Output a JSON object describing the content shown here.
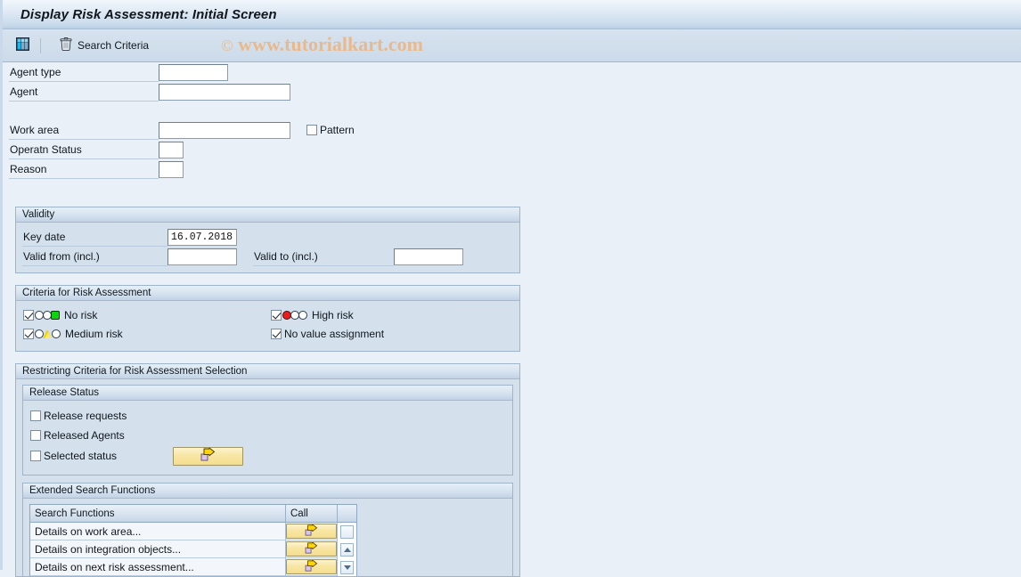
{
  "window": {
    "title": "Display Risk Assessment: Initial Screen"
  },
  "toolbar": {
    "grid_icon": "table-grid-icon",
    "delete_icon": "trash-icon",
    "search_criteria_label": "Search Criteria"
  },
  "watermark": {
    "copyright": "©",
    "text": "www.tutorialkart.com",
    "color": "#e9b98c"
  },
  "form": {
    "agent_type": {
      "label": "Agent type",
      "value": ""
    },
    "agent": {
      "label": "Agent",
      "value": ""
    },
    "work_area": {
      "label": "Work area",
      "value": ""
    },
    "pattern": {
      "label": "Pattern",
      "checked": false
    },
    "operatn_status": {
      "label": "Operatn Status",
      "value": ""
    },
    "reason": {
      "label": "Reason",
      "value": ""
    }
  },
  "validity": {
    "title": "Validity",
    "key_date": {
      "label": "Key date",
      "value": "16.07.2018"
    },
    "valid_from": {
      "label": "Valid from (incl.)",
      "value": ""
    },
    "valid_to": {
      "label": "Valid to (incl.)",
      "value": ""
    }
  },
  "criteria": {
    "title": "Criteria for Risk Assessment",
    "no_risk": {
      "label": "No risk",
      "checked": true,
      "icon": "traffic-light-green-icon"
    },
    "high_risk": {
      "label": "High risk",
      "checked": true,
      "icon": "traffic-light-red-icon"
    },
    "medium_risk": {
      "label": "Medium risk",
      "checked": true,
      "icon": "traffic-light-yellow-icon"
    },
    "no_value_assignment": {
      "label": "No value assignment",
      "checked": true
    }
  },
  "restricting": {
    "title": "Restricting Criteria for Risk Assessment Selection",
    "release_status": {
      "title": "Release Status",
      "release_requests": {
        "label": "Release requests",
        "checked": false
      },
      "released_agents": {
        "label": "Released Agents",
        "checked": false
      },
      "selected_status": {
        "label": "Selected status",
        "checked": false
      },
      "selected_status_button_icon": "call-arrow-icon"
    }
  },
  "extended_search": {
    "title": "Extended Search Functions",
    "columns": [
      "Search Functions",
      "Call"
    ],
    "rows": [
      {
        "name": "Details on work area...",
        "call_icon": "call-arrow-icon"
      },
      {
        "name": "Details on integration objects...",
        "call_icon": "call-arrow-icon"
      },
      {
        "name": "Details on next risk assessment...",
        "call_icon": "call-arrow-icon"
      }
    ],
    "scrollbar": {
      "thumb": "scroll-thumb",
      "up": "scroll-up-arrow-icon",
      "down": "scroll-down-arrow-icon"
    }
  }
}
